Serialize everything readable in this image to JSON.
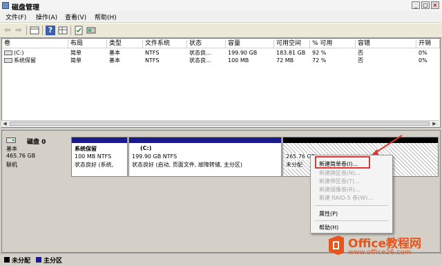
{
  "window": {
    "title": "磁盘管理",
    "buttons": [
      "_",
      "□",
      "×"
    ]
  },
  "menu": [
    {
      "label": "文件(F)"
    },
    {
      "label": "操作(A)"
    },
    {
      "label": "查看(V)"
    },
    {
      "label": "帮助(H)"
    }
  ],
  "toolbar": {
    "icons": [
      "back-arrow-icon",
      "forward-arrow-icon",
      "grid-icon",
      "help-icon",
      "grid2-icon",
      "properties-icon",
      "disk-icon"
    ]
  },
  "table": {
    "columns": [
      "卷",
      "布局",
      "类型",
      "文件系统",
      "状态",
      "容量",
      "可用空间",
      "% 可用",
      "容错",
      "开销"
    ],
    "rows": [
      [
        "(C:)",
        "简单",
        "基本",
        "NTFS",
        "状态良...",
        "199.90 GB",
        "183.81 GB",
        "92 %",
        "否",
        "0%"
      ],
      [
        "系统保留",
        "简单",
        "基本",
        "NTFS",
        "状态良...",
        "100 MB",
        "72 MB",
        "72 %",
        "否",
        "0%"
      ]
    ]
  },
  "disk": {
    "name": "磁盘 0",
    "type": "基本",
    "size": "465.76 GB",
    "status": "联机",
    "partitions": [
      {
        "title": "系统保留",
        "line1": "100 MB NTFS",
        "line2": "状态良好 (系统,"
      },
      {
        "title": "(C:)",
        "line1": "199.90 GB NTFS",
        "line2": "状态良好 (启动, 页面文件, 故障转储, 主分区)"
      },
      {
        "title": "",
        "line1": "265.76 GB",
        "line2": "未分配"
      }
    ]
  },
  "context_menu": [
    {
      "label": "新建简单卷(I)...",
      "enabled": true
    },
    {
      "label": "新建跨区卷(N)...",
      "enabled": false
    },
    {
      "label": "新建带区卷(T)...",
      "enabled": false
    },
    {
      "label": "新建镜像卷(R)...",
      "enabled": false
    },
    {
      "label": "新建 RAID-5 卷(W)...",
      "enabled": false
    },
    {
      "label": "属性(P)",
      "enabled": true
    },
    {
      "label": "帮助(H)",
      "enabled": true
    }
  ],
  "legend": [
    {
      "label": "未分配",
      "color": "#000000"
    },
    {
      "label": "主分区",
      "color": "#1a1a8c"
    }
  ],
  "watermark": {
    "brand": "Office教程网",
    "url": "www.office26.com"
  },
  "colors": {
    "primary_bar": "#1a1a8c",
    "highlight": "#e0382f",
    "logo_orange": "#e8541c"
  }
}
